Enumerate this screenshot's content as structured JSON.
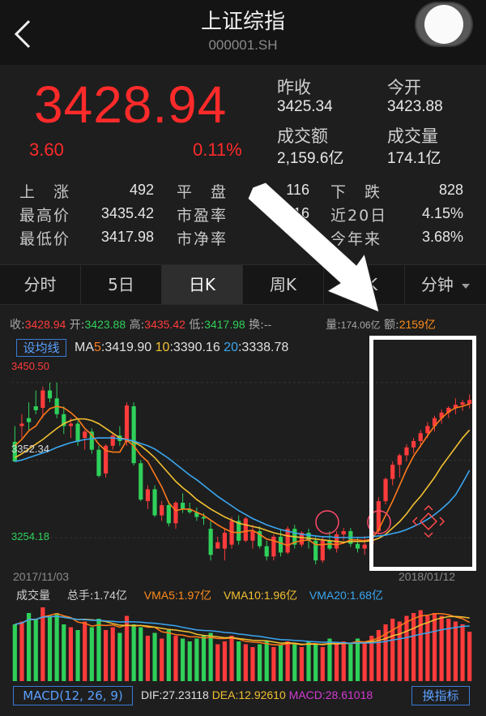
{
  "header": {
    "title": "上证综指",
    "code": "000001.SH"
  },
  "quote": {
    "price": "3428.94",
    "change": "3.60",
    "change_pct": "0.11%",
    "prev_close_label": "昨收",
    "prev_close": "3425.34",
    "open_label": "今开",
    "open": "3423.88",
    "turnover_label": "成交额",
    "turnover": "2,159.6亿",
    "volume_label": "成交量",
    "volume": "174.1亿"
  },
  "stats": {
    "up_label": "上　涨",
    "up": "492",
    "flat_label": "平　盘",
    "flat": "116",
    "down_label": "下　跌",
    "down": "828",
    "high_label": "最高价",
    "high": "3435.42",
    "pe_label": "市盈率",
    "pe": "16",
    "d20_label": "近20日",
    "d20": "4.15%",
    "low_label": "最低价",
    "low": "3417.98",
    "pb_label": "市净率",
    "ytd_label": "今年来",
    "ytd": "3.68%"
  },
  "tabs": [
    "分时",
    "5日",
    "日K",
    "周K",
    "K",
    "分钟"
  ],
  "info": {
    "close_label": "收:",
    "close": "3428.94",
    "open_label": "开:",
    "open": "3423.88",
    "high_label": "高:",
    "high": "3435.42",
    "low_label": "低:",
    "low": "3417.98",
    "turnover_rate_label": "换:",
    "turnover_rate": "--",
    "vol_label": "量:",
    "vol": "174.06亿",
    "amt_label": "额:",
    "amt": "2159亿"
  },
  "ma": {
    "button": "设均线",
    "prefix": "MA",
    "ma5_label": "5",
    "ma5": ":3419.90",
    "ma10_label": "10",
    "ma10": ":3390.16",
    "ma20_label": "20",
    "ma20": ":3338.78"
  },
  "axis": {
    "high": "3450.50",
    "mid": "3352.34",
    "low": "3254.18"
  },
  "dates": {
    "start": "2017/11/03",
    "end": "2018/01/12"
  },
  "volume_legend": {
    "label": "成交量",
    "hand_label": "总手:",
    "hand": "1.74亿",
    "vma5": "VMA5:1.97亿",
    "vma10": "VMA10:1.96亿",
    "vma20": "VMA20:1.68亿"
  },
  "macd": {
    "button": "MACD(12, 26, 9)",
    "dif": "DIF:27.23118",
    "dea": "DEA:12.92610",
    "macd": "MACD:28.61018",
    "switch": "换指标"
  },
  "colors": {
    "up": "#ff3b3b",
    "down": "#2fd05a",
    "ma5": "#ff7a1a",
    "ma10": "#f2c032",
    "ma20": "#3aa6f0",
    "accent": "#5aa0ff",
    "annotation": "#ffffff"
  },
  "chart_data": {
    "type": "candlestick",
    "y_range": [
      3254.18,
      3450.5
    ],
    "ohlc": [
      [
        3375,
        3395,
        3360,
        3350
      ],
      [
        3395,
        3410,
        3380,
        3398
      ],
      [
        3405,
        3425,
        3390,
        3400
      ],
      [
        3420,
        3440,
        3410,
        3415
      ],
      [
        3418,
        3445,
        3405,
        3440
      ],
      [
        3440,
        3450,
        3425,
        3430
      ],
      [
        3430,
        3450,
        3405,
        3410
      ],
      [
        3410,
        3420,
        3385,
        3395
      ],
      [
        3395,
        3405,
        3380,
        3398
      ],
      [
        3398,
        3402,
        3370,
        3375
      ],
      [
        3380,
        3390,
        3365,
        3388
      ],
      [
        3388,
        3392,
        3360,
        3365
      ],
      [
        3365,
        3370,
        3330,
        3332
      ],
      [
        3335,
        3372,
        3330,
        3370
      ],
      [
        3370,
        3385,
        3365,
        3383
      ],
      [
        3383,
        3395,
        3370,
        3376
      ],
      [
        3375,
        3425,
        3370,
        3421
      ],
      [
        3420,
        3425,
        3345,
        3348
      ],
      [
        3348,
        3352,
        3300,
        3302
      ],
      [
        3300,
        3320,
        3290,
        3315
      ],
      [
        3315,
        3320,
        3280,
        3282
      ],
      [
        3282,
        3300,
        3275,
        3295
      ],
      [
        3295,
        3300,
        3268,
        3272
      ],
      [
        3272,
        3300,
        3265,
        3298
      ],
      [
        3298,
        3310,
        3285,
        3290
      ],
      [
        3290,
        3298,
        3284,
        3286
      ],
      [
        3286,
        3292,
        3275,
        3280
      ],
      [
        3280,
        3285,
        3270,
        3278
      ],
      [
        3265,
        3275,
        3225,
        3232
      ],
      [
        3240,
        3255,
        3240,
        3248
      ],
      [
        3240,
        3265,
        3225,
        3260
      ],
      [
        3245,
        3280,
        3240,
        3275
      ],
      [
        3275,
        3282,
        3245,
        3250
      ],
      [
        3250,
        3280,
        3248,
        3278
      ],
      [
        3250,
        3270,
        3240,
        3262
      ],
      [
        3262,
        3268,
        3240,
        3243
      ],
      [
        3243,
        3250,
        3225,
        3230
      ],
      [
        3230,
        3258,
        3225,
        3255
      ],
      [
        3255,
        3265,
        3230,
        3235
      ],
      [
        3235,
        3268,
        3233,
        3265
      ],
      [
        3265,
        3270,
        3240,
        3245
      ],
      [
        3245,
        3262,
        3242,
        3260
      ],
      [
        3260,
        3265,
        3240,
        3250
      ],
      [
        3250,
        3255,
        3220,
        3225
      ],
      [
        3225,
        3255,
        3222,
        3250
      ],
      [
        3250,
        3262,
        3238,
        3240
      ],
      [
        3240,
        3262,
        3235,
        3258
      ],
      [
        3258,
        3266,
        3250,
        3262
      ],
      [
        3262,
        3266,
        3242,
        3246
      ],
      [
        3246,
        3255,
        3235,
        3240
      ],
      [
        3240,
        3256,
        3232,
        3245
      ],
      [
        3245,
        3265,
        3242,
        3262
      ],
      [
        3262,
        3305,
        3258,
        3300
      ],
      [
        3300,
        3330,
        3296,
        3328
      ],
      [
        3328,
        3350,
        3320,
        3346
      ],
      [
        3346,
        3360,
        3330,
        3358
      ],
      [
        3358,
        3372,
        3350,
        3368
      ],
      [
        3368,
        3380,
        3360,
        3376
      ],
      [
        3376,
        3390,
        3368,
        3386
      ],
      [
        3386,
        3400,
        3380,
        3395
      ],
      [
        3395,
        3408,
        3388,
        3405
      ],
      [
        3405,
        3416,
        3398,
        3412
      ],
      [
        3412,
        3420,
        3405,
        3418
      ],
      [
        3418,
        3430,
        3410,
        3422
      ],
      [
        3422,
        3428,
        3414,
        3425
      ],
      [
        3423,
        3435,
        3417,
        3428
      ]
    ],
    "ma5": [
      3370,
      3378,
      3389,
      3395,
      3408,
      3417,
      3420,
      3418,
      3412,
      3404,
      3392,
      3384,
      3372,
      3364,
      3362,
      3362,
      3377,
      3370,
      3358,
      3350,
      3334,
      3318,
      3298,
      3288,
      3290,
      3290,
      3286,
      3282,
      3276,
      3270,
      3265,
      3261,
      3260,
      3262,
      3263,
      3258,
      3252,
      3250,
      3247,
      3244,
      3248,
      3250,
      3251,
      3245,
      3245,
      3246,
      3245,
      3247,
      3251,
      3251,
      3250,
      3252,
      3264,
      3282,
      3300,
      3320,
      3340,
      3357,
      3370,
      3383,
      3395,
      3405,
      3413,
      3418,
      3420,
      3423
    ],
    "ma10": [
      3355,
      3360,
      3366,
      3372,
      3378,
      3385,
      3392,
      3398,
      3402,
      3404,
      3404,
      3402,
      3398,
      3392,
      3386,
      3380,
      3378,
      3375,
      3370,
      3363,
      3355,
      3345,
      3335,
      3325,
      3317,
      3310,
      3302,
      3296,
      3290,
      3285,
      3280,
      3276,
      3272,
      3270,
      3268,
      3266,
      3263,
      3260,
      3258,
      3256,
      3255,
      3254,
      3253,
      3252,
      3251,
      3250,
      3249,
      3248,
      3249,
      3249,
      3249,
      3250,
      3253,
      3258,
      3266,
      3274,
      3284,
      3296,
      3306,
      3318,
      3330,
      3344,
      3356,
      3368,
      3380,
      3390
    ],
    "ma20": [
      3350,
      3352,
      3355,
      3358,
      3361,
      3364,
      3368,
      3371,
      3374,
      3376,
      3378,
      3379,
      3380,
      3380,
      3380,
      3379,
      3378,
      3376,
      3373,
      3370,
      3366,
      3360,
      3354,
      3347,
      3340,
      3333,
      3327,
      3320,
      3313,
      3306,
      3300,
      3294,
      3288,
      3283,
      3278,
      3274,
      3270,
      3267,
      3264,
      3262,
      3260,
      3258,
      3257,
      3256,
      3255,
      3255,
      3254,
      3254,
      3254,
      3254,
      3254,
      3255,
      3256,
      3257,
      3259,
      3261,
      3264,
      3268,
      3272,
      3277,
      3283,
      3290,
      3298,
      3308,
      3323,
      3339
    ],
    "volume": [
      2.0,
      2.1,
      2.4,
      2.2,
      2.6,
      2.3,
      2.4,
      2.0,
      1.9,
      1.8,
      2.1,
      1.9,
      2.2,
      1.8,
      1.9,
      1.7,
      2.3,
      2.0,
      1.9,
      1.6,
      1.7,
      1.5,
      1.8,
      1.6,
      1.5,
      1.4,
      1.5,
      1.6,
      1.7,
      1.3,
      1.4,
      1.6,
      1.4,
      1.3,
      1.2,
      1.3,
      1.4,
      1.2,
      1.3,
      1.4,
      1.3,
      1.2,
      1.4,
      1.3,
      1.2,
      1.5,
      1.3,
      1.4,
      1.3,
      1.5,
      1.4,
      1.6,
      1.8,
      2.0,
      2.2,
      2.1,
      2.3,
      2.4,
      2.5,
      2.3,
      2.4,
      2.3,
      2.2,
      2.1,
      2.0,
      1.74
    ]
  }
}
